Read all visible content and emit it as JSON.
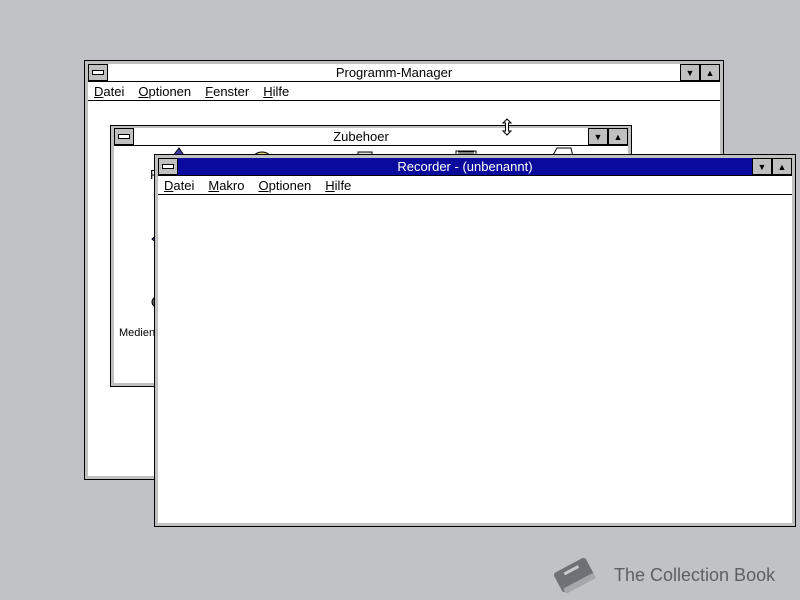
{
  "program_manager": {
    "title": "Programm-Manager",
    "menu": [
      {
        "label": "atei",
        "access": "D"
      },
      {
        "label": "ptionen",
        "access": "O"
      },
      {
        "label": "enster",
        "access": "F"
      },
      {
        "label": "ilfe",
        "access": "H"
      }
    ]
  },
  "zubehoer": {
    "title": "Zubehoer",
    "partial_labels": [
      "R",
      "Medien"
    ]
  },
  "recorder": {
    "title": "Recorder - (unbenannt)",
    "menu": [
      {
        "label": "atei",
        "access": "D"
      },
      {
        "label": "akro",
        "access": "M"
      },
      {
        "label": "ptionen",
        "access": "O"
      },
      {
        "label": "ilfe",
        "access": "H"
      }
    ]
  },
  "watermark": {
    "text": "The Collection Book"
  },
  "colors": {
    "desktop": "#c0c2c5",
    "active_title": "#0a0a9c",
    "frame": "#c0c0c0"
  }
}
